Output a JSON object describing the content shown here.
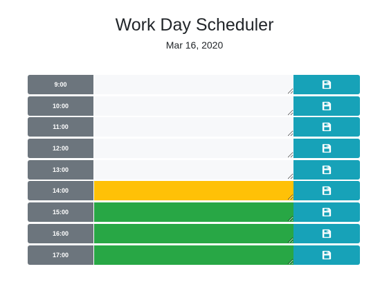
{
  "header": {
    "title": "Work Day Scheduler",
    "date": "Mar 16, 2020"
  },
  "colors": {
    "hour_block": "#6c757d",
    "past": "#f7f8fa",
    "present": "#ffc107",
    "future": "#28a745",
    "save_button": "#17a2b8"
  },
  "save_icon": "floppy-disk-icon",
  "rows": [
    {
      "hour": "9:00",
      "state": "past",
      "text": ""
    },
    {
      "hour": "10:00",
      "state": "past",
      "text": ""
    },
    {
      "hour": "11:00",
      "state": "past",
      "text": ""
    },
    {
      "hour": "12:00",
      "state": "past",
      "text": ""
    },
    {
      "hour": "13:00",
      "state": "past",
      "text": ""
    },
    {
      "hour": "14:00",
      "state": "present",
      "text": ""
    },
    {
      "hour": "15:00",
      "state": "future",
      "text": ""
    },
    {
      "hour": "16:00",
      "state": "future",
      "text": ""
    },
    {
      "hour": "17:00",
      "state": "future",
      "text": ""
    }
  ]
}
